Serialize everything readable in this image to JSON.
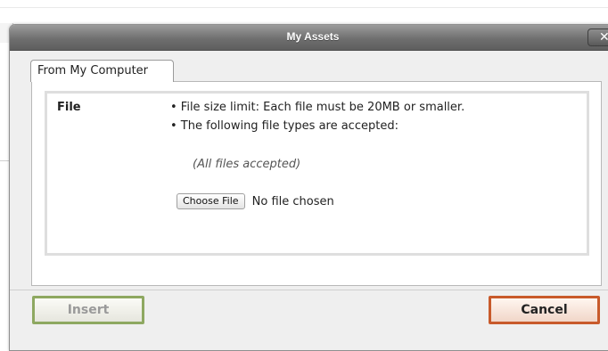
{
  "dialog": {
    "title": "My Assets",
    "close_label": "✕"
  },
  "tabs": [
    {
      "label": "From My Computer"
    }
  ],
  "upload": {
    "field_label": "File",
    "bullets": [
      "• File size limit: Each file must be 20MB or smaller.",
      "• The following file types are accepted:"
    ],
    "accepted_types": "(All files accepted)",
    "choose_file_label": "Choose File",
    "file_status": "No file chosen"
  },
  "buttons": {
    "insert_label": "Insert",
    "cancel_label": "Cancel"
  },
  "colors": {
    "insert_border": "#8ea861",
    "cancel_border": "#c85a2b",
    "titlebar": "#6f6f6f"
  }
}
